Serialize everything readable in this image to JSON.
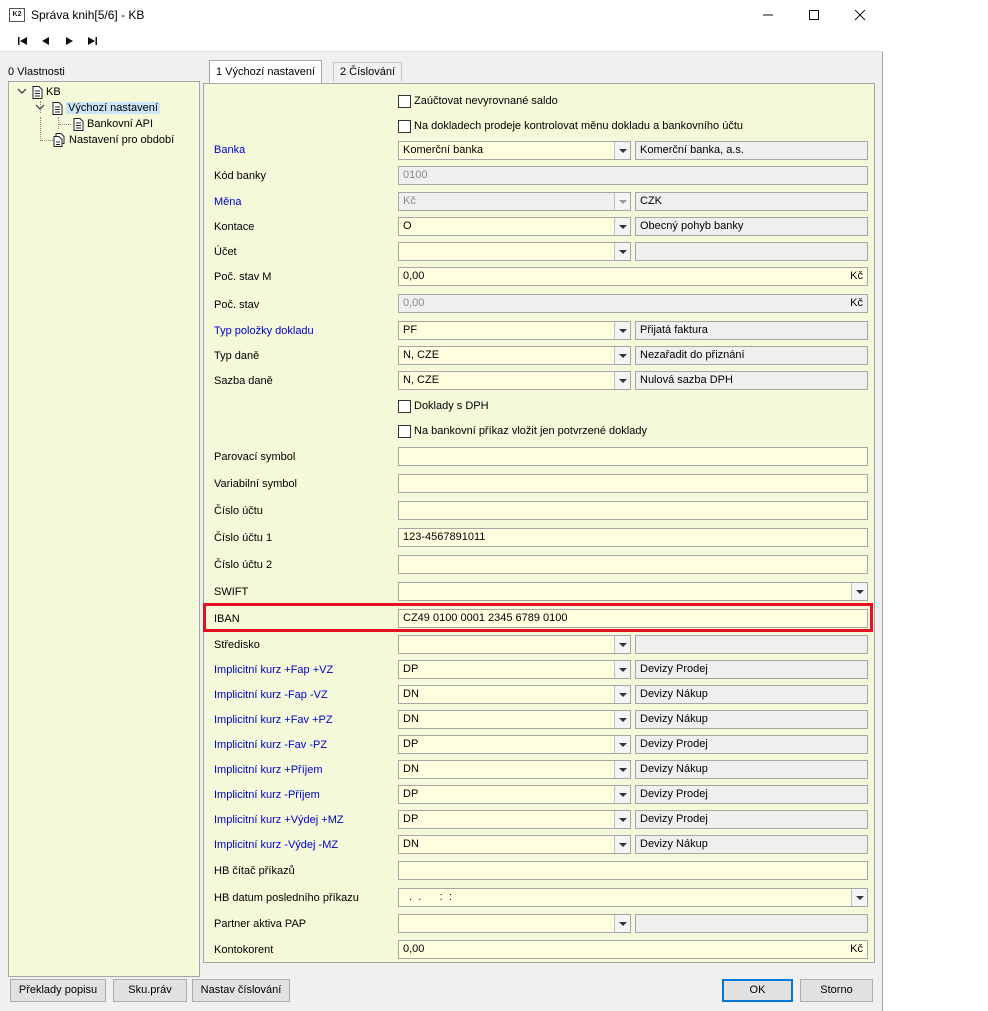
{
  "window": {
    "title": "Správa knih[5/6] - KB",
    "icon_label": "K2"
  },
  "tree": {
    "panel_label": "0 Vlastnosti",
    "nodes": [
      {
        "label": "KB"
      },
      {
        "label": "Výchozí nastavení",
        "selected": true
      },
      {
        "label": "Bankovní API"
      },
      {
        "label": "Nastavení pro období"
      }
    ]
  },
  "tabs": [
    {
      "label": "1 Výchozí nastavení",
      "active": true
    },
    {
      "label": "2 Číslování",
      "active": false
    }
  ],
  "form": {
    "checkbox_1": {
      "label": "Zaúčtovat nevyrovnané saldo",
      "checked": false
    },
    "checkbox_2": {
      "label": "Na dokladech prodeje kontrolovat měnu dokladu a bankovního účtu",
      "checked": false
    },
    "banka": {
      "label": "Banka",
      "value": "Komerční banka",
      "desc": "Komerční banka, a.s."
    },
    "kod_banky": {
      "label": "Kód banky",
      "value": "0100"
    },
    "mena": {
      "label": "Měna",
      "value": "Kč",
      "desc": "CZK"
    },
    "kontace": {
      "label": "Kontace",
      "value": "O",
      "desc": "Obecný pohyb banky"
    },
    "ucet": {
      "label": "Účet",
      "value": "",
      "desc": ""
    },
    "poc_stav_m": {
      "label": "Poč. stav M",
      "value": "0,00",
      "unit": "Kč"
    },
    "poc_stav": {
      "label": "Poč. stav",
      "value": "0,00",
      "unit": "Kč"
    },
    "typ_polozky": {
      "label": "Typ položky dokladu",
      "value": "PF",
      "desc": "Přijatá faktura"
    },
    "typ_dane": {
      "label": "Typ daně",
      "value": "N, CZE",
      "desc": "Nezařadit do přiznání"
    },
    "sazba_dane": {
      "label": "Sazba daně",
      "value": "N, CZE",
      "desc": "Nulová sazba DPH"
    },
    "checkbox_3": {
      "label": "Doklady s DPH",
      "checked": false
    },
    "checkbox_4": {
      "label": "Na bankovní příkaz vložit jen potvrzené doklady",
      "checked": false
    },
    "parovaci_symbol": {
      "label": "Parovací symbol",
      "value": ""
    },
    "variabilni_symbol": {
      "label": "Variabilní symbol",
      "value": ""
    },
    "cislo_uctu": {
      "label": "Číslo účtu",
      "value": ""
    },
    "cislo_uctu_1": {
      "label": "Číslo účtu 1",
      "value": "123-4567891011"
    },
    "cislo_uctu_2": {
      "label": "Číslo účtu 2",
      "value": ""
    },
    "swift": {
      "label": "SWIFT",
      "value": ""
    },
    "iban": {
      "label": "IBAN",
      "value": "CZ49 0100 0001 2345 6789 0100"
    },
    "stredisko": {
      "label": "Středisko",
      "value": "",
      "desc": ""
    },
    "kurz_fap_vz": {
      "label": "Implicitní kurz +Fap +VZ",
      "value": "DP",
      "desc": "Devizy Prodej"
    },
    "kurz_fap_vz_minus": {
      "label": "Implicitní kurz -Fap -VZ",
      "value": "DN",
      "desc": "Devizy Nákup"
    },
    "kurz_fav_pz": {
      "label": "Implicitní kurz +Fav +PZ",
      "value": "DN",
      "desc": "Devizy Nákup"
    },
    "kurz_fav_pz_minus": {
      "label": "Implicitní kurz -Fav -PZ",
      "value": "DP",
      "desc": "Devizy Prodej"
    },
    "kurz_prijem": {
      "label": "Implicitní kurz +Příjem",
      "value": "DN",
      "desc": "Devizy Nákup"
    },
    "kurz_prijem_minus": {
      "label": "Implicitní kurz -Příjem",
      "value": "DP",
      "desc": "Devizy Prodej"
    },
    "kurz_vydej_mz": {
      "label": "Implicitní kurz +Výdej +MZ",
      "value": "DP",
      "desc": "Devizy Prodej"
    },
    "kurz_vydej_mz_minus": {
      "label": "Implicitní kurz -Výdej -MZ",
      "value": "DN",
      "desc": "Devizy Nákup"
    },
    "hb_citac": {
      "label": "HB čítač příkazů",
      "value": ""
    },
    "hb_datum": {
      "label": "HB datum posledního příkazu",
      "value": "  .  .      :  :"
    },
    "partner_pap": {
      "label": "Partner aktiva PAP",
      "value": "",
      "desc": ""
    },
    "kontokorent": {
      "label": "Kontokorent",
      "value": "0,00",
      "unit": "Kč"
    }
  },
  "buttons": {
    "preklady": "Překlady popisu",
    "sku_prav": "Sku.práv",
    "nastav_cislovani": "Nastav číslování",
    "ok": "OK",
    "storno": "Storno"
  },
  "colors": {
    "form_bg": "#f4f9d9",
    "input_bg": "#ffffe0",
    "link_label": "#0000cc",
    "highlight": "#e81123"
  }
}
